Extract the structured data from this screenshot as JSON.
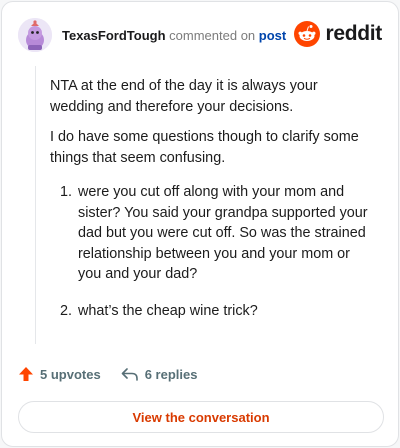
{
  "comment": {
    "username": "TexasFordTough",
    "action_text": "commented on",
    "post_link": "post",
    "paragraphs": [
      "NTA at the end of the day it is always your wedding and therefore your decisions.",
      "I do have some questions though to clarify some things that seem confusing."
    ],
    "list_items": [
      "were you cut off along with your mom and sister? You said your grandpa supported your dad but you were cut off. So was the strained relationship between you and your mom or you and your dad?",
      "what’s the cheap wine trick?"
    ]
  },
  "brand": {
    "logo_text": "reddit",
    "icon": "reddit-snoo-icon",
    "accent_color": "#ff4500"
  },
  "footer": {
    "upvotes_label": "5 upvotes",
    "replies_label": "6 replies",
    "upvote_icon": "upvote-arrow-icon",
    "reply_icon": "reply-arrow-icon",
    "upvote_color": "#ff4500"
  },
  "cta": {
    "label": "View the conversation",
    "color": "#d93a00"
  }
}
